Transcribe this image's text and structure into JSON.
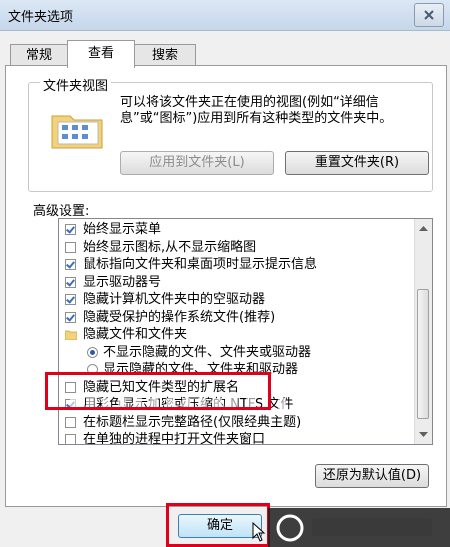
{
  "window": {
    "title": "文件夹选项"
  },
  "tabs": [
    {
      "label": "常规"
    },
    {
      "label": "查看"
    },
    {
      "label": "搜索"
    }
  ],
  "folder_views": {
    "legend": "文件夹视图",
    "description": "可以将该文件夹正在使用的视图(例如“详细信息”或“图标”)应用到所有这种类型的文件夹中。",
    "apply_button": "应用到文件夹(L)",
    "reset_button": "重置文件夹(R)"
  },
  "advanced": {
    "label": "高级设置:",
    "items": [
      {
        "type": "checkbox",
        "checked": true,
        "label": "始终显示菜单"
      },
      {
        "type": "checkbox",
        "checked": false,
        "label": "始终显示图标,从不显示缩略图"
      },
      {
        "type": "checkbox",
        "checked": true,
        "label": "鼠标指向文件夹和桌面项时显示提示信息"
      },
      {
        "type": "checkbox",
        "checked": true,
        "label": "显示驱动器号"
      },
      {
        "type": "checkbox",
        "checked": true,
        "label": "隐藏计算机文件夹中的空驱动器"
      },
      {
        "type": "checkbox",
        "checked": true,
        "label": "隐藏受保护的操作系统文件(推荐)"
      },
      {
        "type": "folder",
        "label": "隐藏文件和文件夹"
      },
      {
        "type": "radio",
        "selected": true,
        "label": "不显示隐藏的文件、文件夹或驱动器"
      },
      {
        "type": "radio",
        "selected": false,
        "label": "显示隐藏的文件、文件夹和驱动器"
      },
      {
        "type": "checkbox",
        "checked": false,
        "label": "隐藏已知文件类型的扩展名"
      },
      {
        "type": "checkbox",
        "checked": true,
        "label": "用彩色显示加密或压缩的 NTFS 文件"
      },
      {
        "type": "checkbox",
        "checked": false,
        "label": "在标题栏显示完整路径(仅限经典主题)"
      },
      {
        "type": "checkbox",
        "checked": false,
        "label": "在单独的进程中打开文件夹窗口"
      }
    ],
    "restore_button": "还原为默认值(D)"
  },
  "footer": {
    "ok_button": "确定"
  },
  "colors": {
    "highlight": "#e0001b",
    "accent": "#3c6fb4"
  }
}
